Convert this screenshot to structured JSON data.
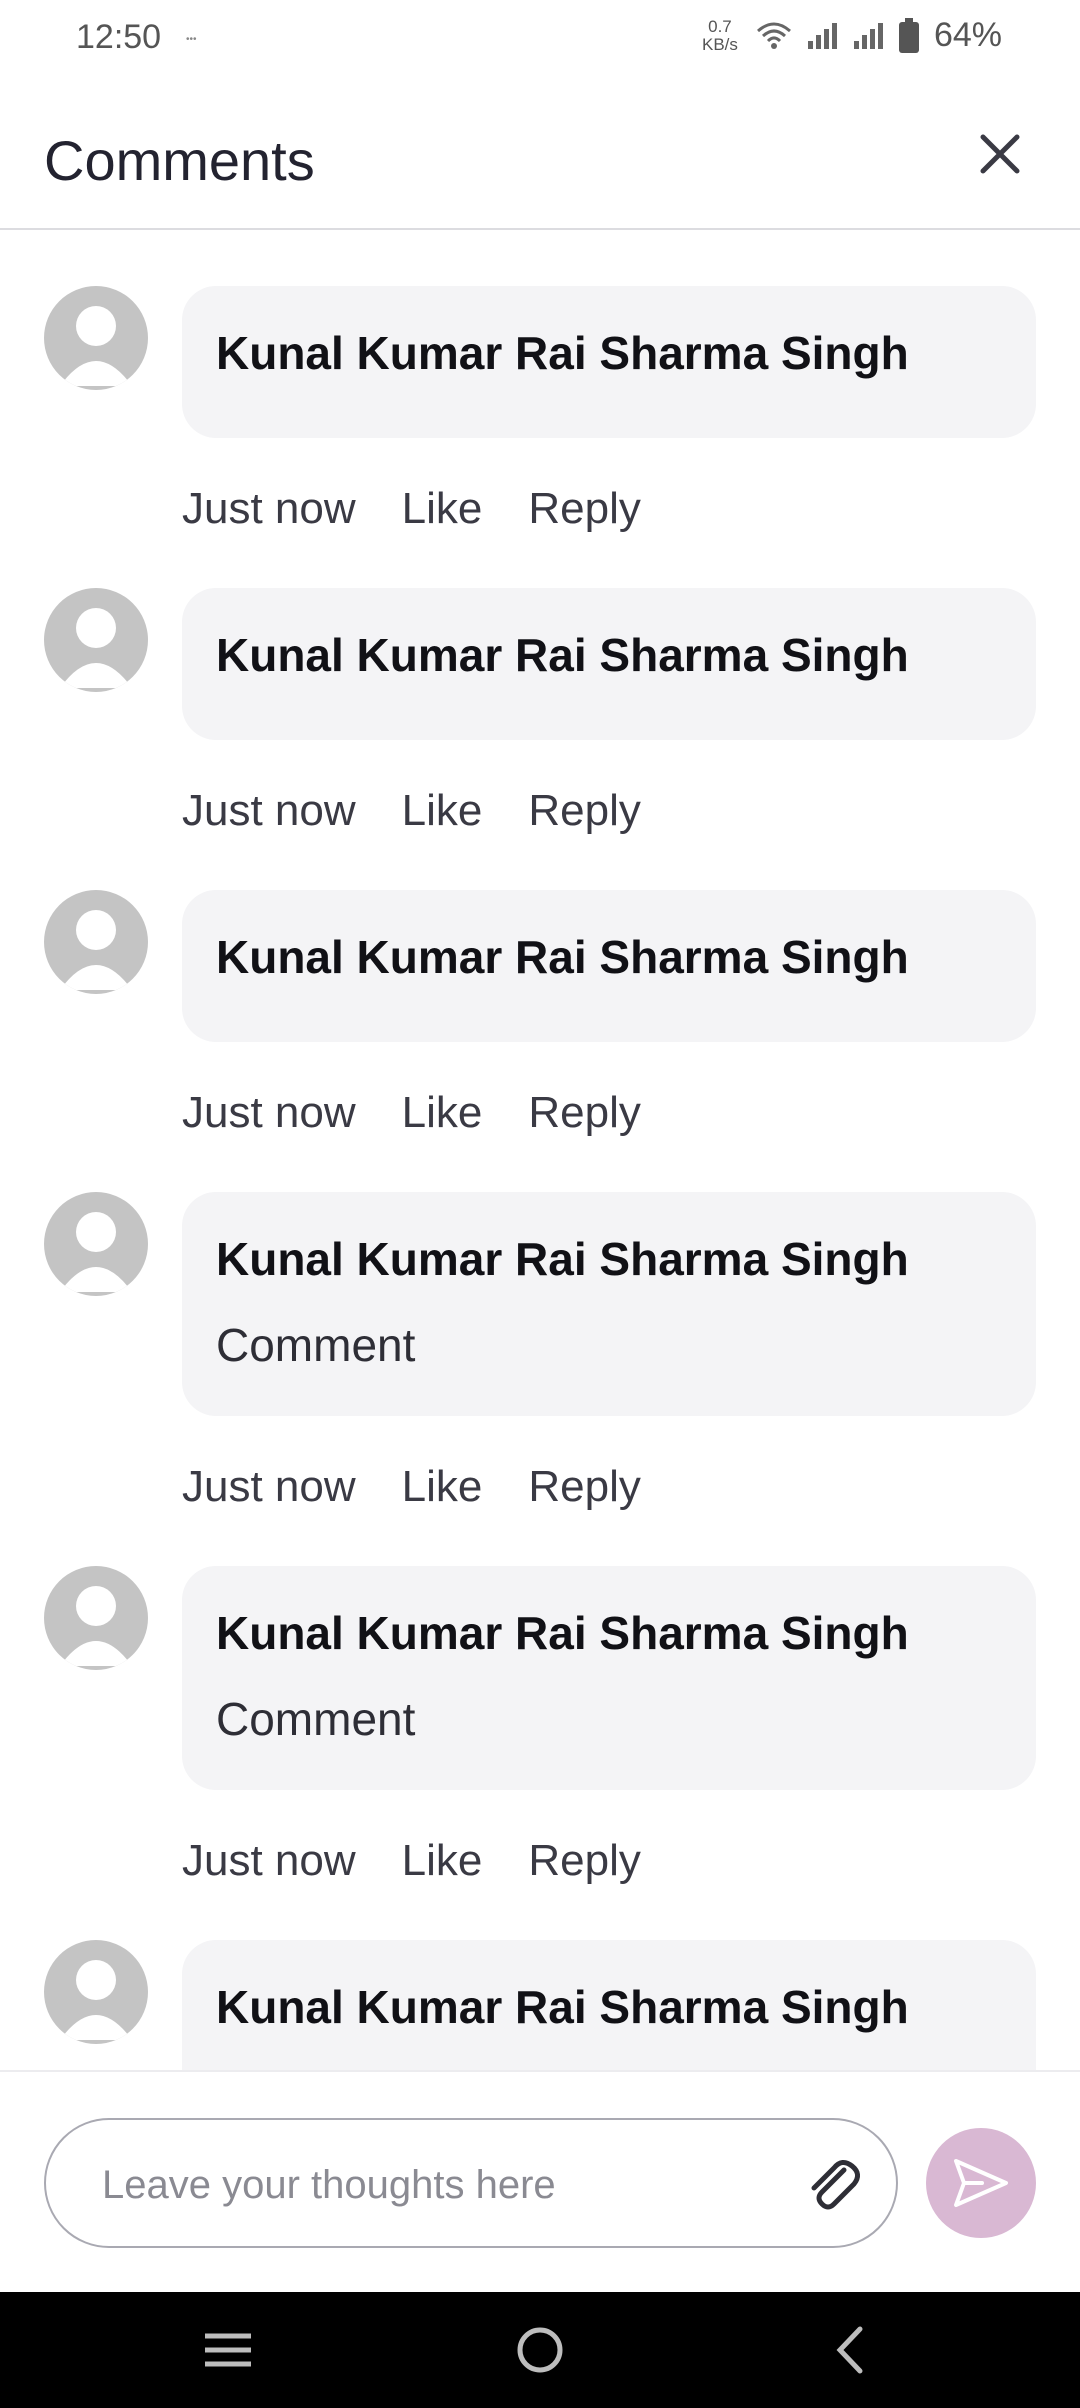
{
  "status_bar": {
    "time": "12:50",
    "net_speed_value": "0.7",
    "net_speed_unit": "KB/s",
    "battery_percent": "64%"
  },
  "header": {
    "title": "Comments",
    "close_icon": "close-icon"
  },
  "comments": [
    {
      "author": "Kunal Kumar Rai Sharma Singh",
      "text": "",
      "time": "Just now",
      "like_label": "Like",
      "reply_label": "Reply"
    },
    {
      "author": "Kunal Kumar Rai Sharma Singh",
      "text": "",
      "time": "Just now",
      "like_label": "Like",
      "reply_label": "Reply"
    },
    {
      "author": "Kunal Kumar Rai Sharma Singh",
      "text": "",
      "time": "Just now",
      "like_label": "Like",
      "reply_label": "Reply"
    },
    {
      "author": "Kunal Kumar Rai Sharma Singh",
      "text": "Comment",
      "time": "Just now",
      "like_label": "Like",
      "reply_label": "Reply"
    },
    {
      "author": "Kunal Kumar Rai Sharma Singh",
      "text": "Comment",
      "time": "Just now",
      "like_label": "Like",
      "reply_label": "Reply"
    },
    {
      "author": "Kunal Kumar Rai Sharma Singh",
      "text": "",
      "time": "",
      "like_label": "",
      "reply_label": ""
    }
  ],
  "composer": {
    "placeholder": "Leave your thoughts here",
    "value": "",
    "attach_icon": "paperclip-icon",
    "send_icon": "send-icon"
  },
  "colors": {
    "send_button_bg": "#d9b8d3",
    "bubble_bg": "#f4f4f6",
    "avatar_bg": "#c4c4c4"
  },
  "nav_bar": {
    "recents_icon": "menu-icon",
    "home_icon": "home-circle-icon",
    "back_icon": "back-chevron-icon"
  }
}
